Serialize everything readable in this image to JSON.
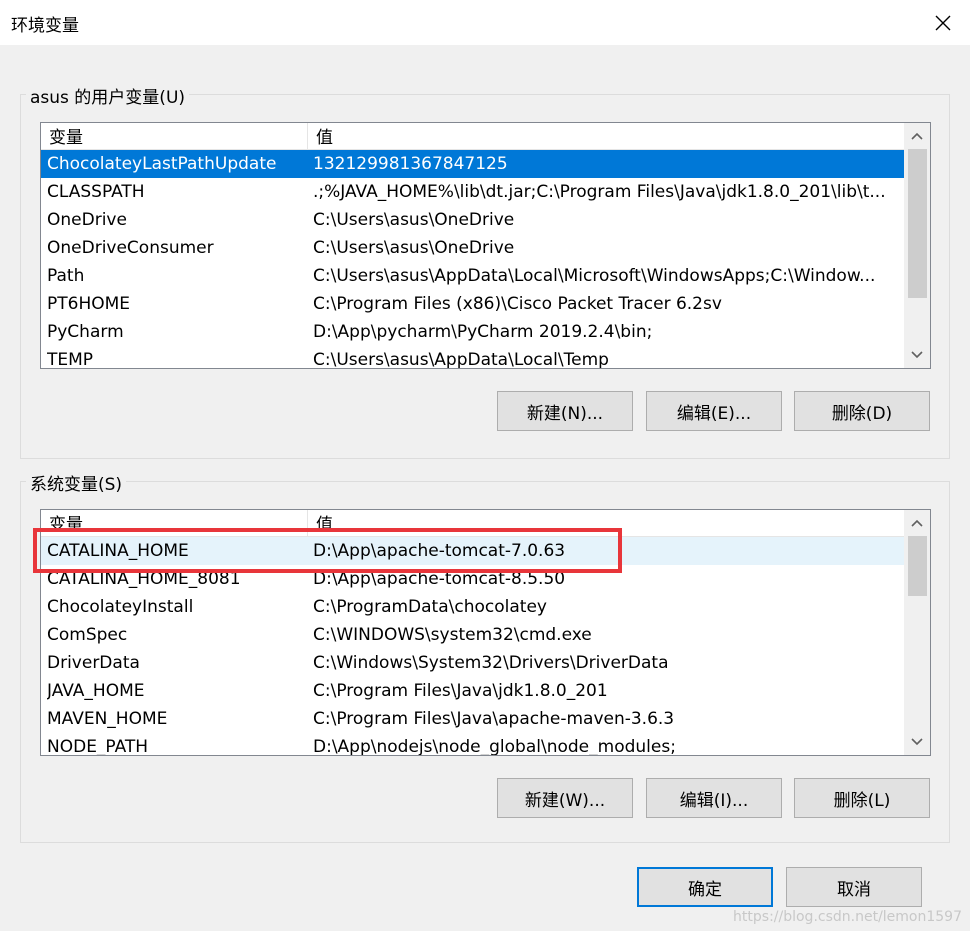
{
  "window": {
    "title": "环境变量"
  },
  "user_vars": {
    "group_label": "asus 的用户变量(U)",
    "columns": [
      "变量",
      "值"
    ],
    "rows": [
      [
        "ChocolateyLastPathUpdate",
        "132129981367847125"
      ],
      [
        "CLASSPATH",
        ".;%JAVA_HOME%\\lib\\dt.jar;C:\\Program Files\\Java\\jdk1.8.0_201\\lib\\t..."
      ],
      [
        "OneDrive",
        "C:\\Users\\asus\\OneDrive"
      ],
      [
        "OneDriveConsumer",
        "C:\\Users\\asus\\OneDrive"
      ],
      [
        "Path",
        "C:\\Users\\asus\\AppData\\Local\\Microsoft\\WindowsApps;C:\\Window..."
      ],
      [
        "PT6HOME",
        "C:\\Program Files (x86)\\Cisco Packet Tracer 6.2sv"
      ],
      [
        "PyCharm",
        "D:\\App\\pycharm\\PyCharm 2019.2.4\\bin;"
      ],
      [
        "TEMP",
        "C:\\Users\\asus\\AppData\\Local\\Temp"
      ]
    ],
    "buttons": {
      "new": "新建(N)...",
      "edit": "编辑(E)...",
      "delete": "删除(D)"
    }
  },
  "system_vars": {
    "group_label": "系统变量(S)",
    "columns": [
      "变量",
      "值"
    ],
    "rows": [
      [
        "CATALINA_HOME",
        "D:\\App\\apache-tomcat-7.0.63"
      ],
      [
        "CATALINA_HOME_8081",
        "D:\\App\\apache-tomcat-8.5.50"
      ],
      [
        "ChocolateyInstall",
        "C:\\ProgramData\\chocolatey"
      ],
      [
        "ComSpec",
        "C:\\WINDOWS\\system32\\cmd.exe"
      ],
      [
        "DriverData",
        "C:\\Windows\\System32\\Drivers\\DriverData"
      ],
      [
        "JAVA_HOME",
        "C:\\Program Files\\Java\\jdk1.8.0_201"
      ],
      [
        "MAVEN_HOME",
        "C:\\Program Files\\Java\\apache-maven-3.6.3"
      ],
      [
        "NODE_PATH",
        "D:\\App\\nodejs\\node_global\\node_modules;"
      ]
    ],
    "buttons": {
      "new": "新建(W)...",
      "edit": "编辑(I)...",
      "delete": "删除(L)"
    }
  },
  "footer": {
    "ok": "确定",
    "cancel": "取消"
  },
  "watermark": "https://blog.csdn.net/lemon1597",
  "icons": {
    "close": "close-icon",
    "up": "chevron-up-icon",
    "down": "chevron-down-icon"
  },
  "colors": {
    "selection": "#0078d7",
    "highlight_box": "#e8353a"
  }
}
